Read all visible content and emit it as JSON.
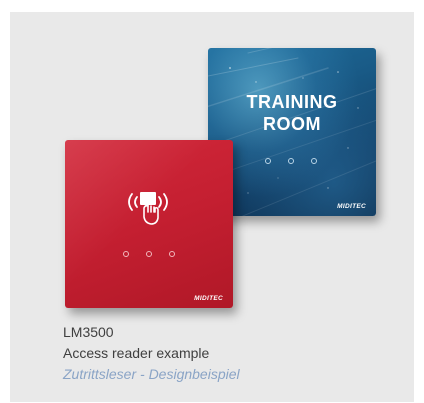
{
  "panels": {
    "training": {
      "line1": "TRAINING",
      "line2": "ROOM",
      "brand": "MIDITEC",
      "icon": "three-dot-indicator-icon"
    },
    "reader": {
      "brand": "MIDITEC",
      "icon": "rfid-card-hand-icon"
    }
  },
  "caption": {
    "model": "LM3500",
    "description": "Access reader example",
    "description_de": "Zutrittsleser - Designbeispiel"
  },
  "colors": {
    "panel_blue": "#195a86",
    "panel_red": "#c41f31",
    "caption_text": "#3f3f3f",
    "caption_german": "#8aa4c6",
    "card_background": "#e9e9e9"
  }
}
